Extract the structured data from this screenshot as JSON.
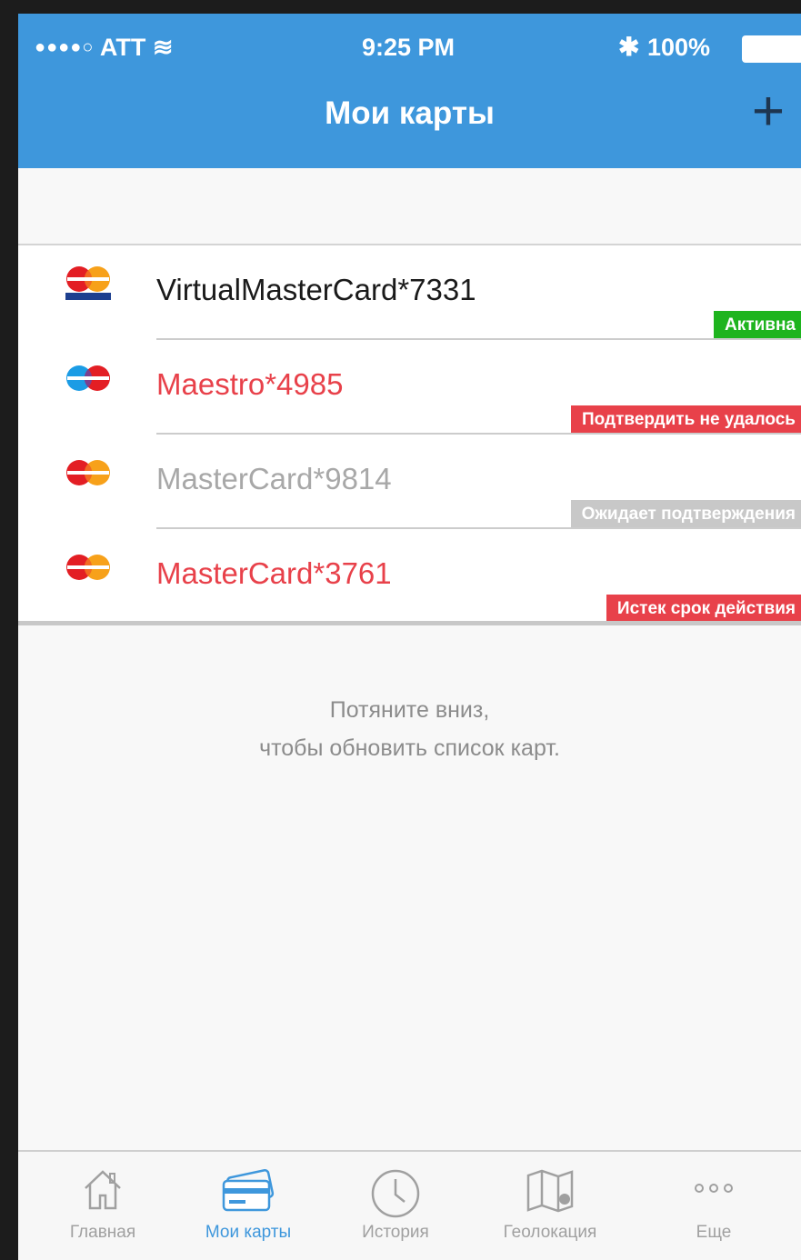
{
  "status_bar": {
    "carrier": "ATT",
    "time": "9:25 PM",
    "battery": "100%"
  },
  "header": {
    "title": "Мои карты",
    "add_label": "+"
  },
  "cards": [
    {
      "name": "VirtualMasterCard*7331",
      "status": "Активна",
      "name_color": "#1a1a1a",
      "badge_color": "#1eb41e",
      "logo": "virtual-mastercard-logo"
    },
    {
      "name": "Maestro*4985",
      "status": "Подтвердить не удалось",
      "name_color": "#e8414a",
      "badge_color": "#e8414a",
      "logo": "maestro-logo"
    },
    {
      "name": "MasterCard*9814",
      "status": "Ожидает подтверждения",
      "name_color": "#a8a8a8",
      "badge_color": "#c8c8c8",
      "logo": "mastercard-logo"
    },
    {
      "name": "MasterCard*3761",
      "status": "Истек срок действия",
      "name_color": "#e8414a",
      "badge_color": "#e8414a",
      "logo": "mastercard-logo"
    }
  ],
  "hint": {
    "line1": "Потяните вниз,",
    "line2": "чтобы обновить список карт."
  },
  "tabs": [
    {
      "label": "Главная",
      "icon": "home-icon"
    },
    {
      "label": "Мои карты",
      "icon": "card-icon",
      "active": true
    },
    {
      "label": "История",
      "icon": "clock-icon"
    },
    {
      "label": "Геолокация",
      "icon": "map-icon"
    },
    {
      "label": "Еще",
      "icon": "more-icon"
    }
  ],
  "colors": {
    "accent": "#3e97dc"
  }
}
